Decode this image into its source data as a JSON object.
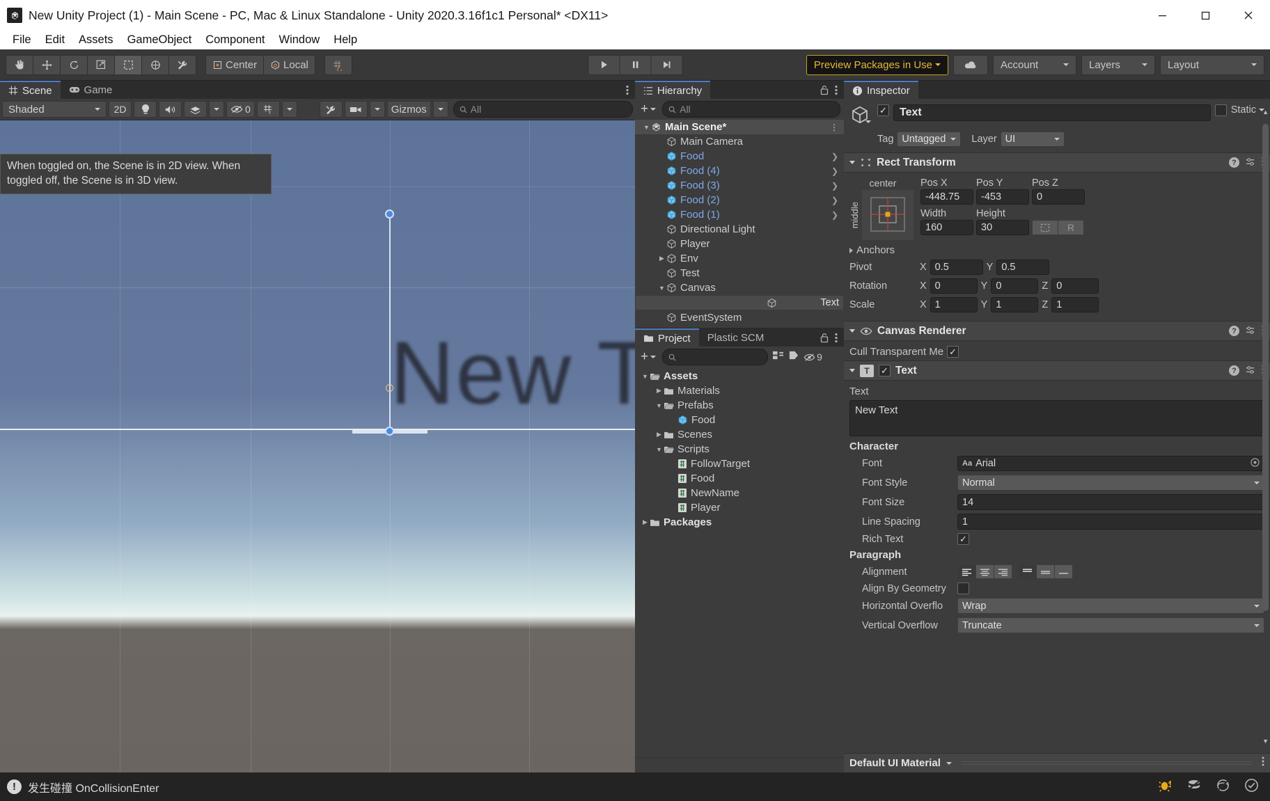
{
  "window": {
    "title": "New Unity Project (1) - Main Scene - PC, Mac & Linux Standalone - Unity 2020.3.16f1c1 Personal* <DX11>",
    "app_icon": "unity-icon",
    "minimize": "–",
    "maximize": "☐",
    "close": "✕"
  },
  "menubar": {
    "items": [
      "File",
      "Edit",
      "Assets",
      "GameObject",
      "Component",
      "Window",
      "Help"
    ]
  },
  "toolbar": {
    "tools": [
      {
        "name": "hand-tool",
        "glyph": "✋"
      },
      {
        "name": "move-tool",
        "glyph": "✥"
      },
      {
        "name": "rotate-tool",
        "glyph": "⟳"
      },
      {
        "name": "scale-tool",
        "glyph": "↗"
      },
      {
        "name": "rect-tool",
        "glyph": "⬚"
      },
      {
        "name": "transform-tool",
        "glyph": "⊕"
      },
      {
        "name": "custom-editor-tool",
        "glyph": "⚒"
      }
    ],
    "pivot_label": "Center",
    "rotation_label": "Local",
    "grid_label": "",
    "play": "▶",
    "pause": "‖",
    "step": "▶|",
    "preview_packages": "Preview Packages in Use",
    "cloud_label": "cloud-icon",
    "account": "Account",
    "layers": "Layers",
    "layout": "Layout"
  },
  "scene": {
    "tabs": [
      {
        "label": "Scene",
        "icon": "grid-icon",
        "active": true
      },
      {
        "label": "Game",
        "icon": "gamepad-icon",
        "active": false
      }
    ],
    "draw_mode": "Shaded",
    "toggle_2d": "2D",
    "lighting_icon": "lightbulb-icon",
    "audio_icon": "speaker-icon",
    "fx_icon": "fx-icon",
    "hidden_count": "0",
    "grid_icon": "grid-visibility-icon",
    "tools_icon": "component-tools-icon",
    "camera_icon": "scene-camera-icon",
    "gizmos_label": "Gizmos",
    "search_placeholder": "All",
    "tooltip": "When toggled on, the Scene is in 2D view. When toggled off, the Scene is in 3D view.",
    "viewport_text": "New T"
  },
  "hierarchy": {
    "tab_label": "Hierarchy",
    "tab_icon": "hierarchy-icon",
    "lock_icon": "lock-icon",
    "menu_icon": "kebab-icon",
    "add_label": "+",
    "search_placeholder": "All",
    "items": [
      {
        "label": "Main Scene*",
        "depth": 0,
        "icon": "unity-scene-icon",
        "expanded": true,
        "kind": "scene",
        "selected": false,
        "prefab": false
      },
      {
        "label": "Main Camera",
        "depth": 1,
        "icon": "gameobject-icon",
        "kind": "go",
        "blue": false,
        "prefab": false
      },
      {
        "label": "Food",
        "depth": 1,
        "icon": "prefab-icon",
        "kind": "prefab",
        "blue": true,
        "prefab": true
      },
      {
        "label": "Food (4)",
        "depth": 1,
        "icon": "prefab-icon",
        "kind": "prefab",
        "blue": true,
        "prefab": true
      },
      {
        "label": "Food (3)",
        "depth": 1,
        "icon": "prefab-icon",
        "kind": "prefab",
        "blue": true,
        "prefab": true
      },
      {
        "label": "Food (2)",
        "depth": 1,
        "icon": "prefab-icon",
        "kind": "prefab",
        "blue": true,
        "prefab": true
      },
      {
        "label": "Food (1)",
        "depth": 1,
        "icon": "prefab-icon",
        "kind": "prefab",
        "blue": true,
        "prefab": true
      },
      {
        "label": "Directional Light",
        "depth": 1,
        "icon": "gameobject-icon",
        "kind": "go",
        "blue": false,
        "prefab": false
      },
      {
        "label": "Player",
        "depth": 1,
        "icon": "gameobject-icon",
        "kind": "go",
        "blue": false,
        "prefab": false
      },
      {
        "label": "Env",
        "depth": 1,
        "icon": "gameobject-icon",
        "kind": "go",
        "blue": false,
        "prefab": false,
        "collapsed": true
      },
      {
        "label": "Test",
        "depth": 1,
        "icon": "gameobject-icon",
        "kind": "go",
        "blue": false,
        "prefab": false
      },
      {
        "label": "Canvas",
        "depth": 1,
        "icon": "gameobject-icon",
        "kind": "go",
        "blue": false,
        "prefab": false,
        "expanded": true
      },
      {
        "label": "Text",
        "depth": 2,
        "icon": "gameobject-icon",
        "kind": "go",
        "blue": false,
        "prefab": false,
        "selected": true
      },
      {
        "label": "EventSystem",
        "depth": 1,
        "icon": "gameobject-icon",
        "kind": "go",
        "blue": false,
        "prefab": false
      }
    ]
  },
  "project": {
    "tabs": [
      {
        "label": "Project",
        "icon": "folder-icon",
        "active": true
      },
      {
        "label": "Plastic SCM",
        "icon": "",
        "active": false
      }
    ],
    "lock_icon": "lock-icon",
    "menu_icon": "kebab-icon",
    "add_label": "+",
    "search_placeholder": "",
    "badge_count": "9",
    "items": [
      {
        "label": "Assets",
        "depth": 0,
        "icon": "folder-open-icon",
        "expanded": true,
        "bold": true
      },
      {
        "label": "Materials",
        "depth": 1,
        "icon": "folder-icon",
        "expanded": false
      },
      {
        "label": "Prefabs",
        "depth": 1,
        "icon": "folder-open-icon",
        "expanded": true
      },
      {
        "label": "Food",
        "depth": 2,
        "icon": "prefab-icon"
      },
      {
        "label": "Scenes",
        "depth": 1,
        "icon": "folder-icon",
        "expanded": false
      },
      {
        "label": "Scripts",
        "depth": 1,
        "icon": "folder-open-icon",
        "expanded": true
      },
      {
        "label": "FollowTarget",
        "depth": 2,
        "icon": "csharp-icon"
      },
      {
        "label": "Food",
        "depth": 2,
        "icon": "csharp-icon"
      },
      {
        "label": "NewName",
        "depth": 2,
        "icon": "csharp-icon"
      },
      {
        "label": "Player",
        "depth": 2,
        "icon": "csharp-icon"
      },
      {
        "label": "Packages",
        "depth": 0,
        "icon": "folder-icon",
        "expanded": false,
        "bold": true
      }
    ]
  },
  "inspector": {
    "tab_label": "Inspector",
    "tab_icon": "info-icon",
    "object_name": "Text",
    "enabled": true,
    "static_label": "Static",
    "static_checked": false,
    "tag_label": "Tag",
    "tag_value": "Untagged",
    "layer_label": "Layer",
    "layer_value": "UI",
    "rect_transform": {
      "title": "Rect Transform",
      "anchor_preset_h": "center",
      "anchor_preset_v": "middle",
      "fields": [
        {
          "label": "Pos X",
          "value": "-448.75"
        },
        {
          "label": "Pos Y",
          "value": "-453"
        },
        {
          "label": "Pos Z",
          "value": "0"
        }
      ],
      "size_fields": [
        {
          "label": "Width",
          "value": "160"
        },
        {
          "label": "Height",
          "value": "30"
        }
      ],
      "blueprint_btn": "blueprint-mode-icon",
      "raw_btn": "R",
      "anchors_label": "Anchors",
      "pivot_label": "Pivot",
      "pivot_x": "0.5",
      "pivot_y": "0.5",
      "rotation_label": "Rotation",
      "rotation": [
        "0",
        "0",
        "0"
      ],
      "scale_label": "Scale",
      "scale": [
        "1",
        "1",
        "1"
      ],
      "axes": [
        "X",
        "Y",
        "Z"
      ]
    },
    "canvas_renderer": {
      "title": "Canvas Renderer",
      "cull_label": "Cull Transparent Me",
      "cull_checked": true
    },
    "text_component": {
      "title": "Text",
      "enabled": true,
      "text_label": "Text",
      "text_value": "New Text",
      "character_header": "Character",
      "font_label": "Font",
      "font_value": "Arial",
      "font_style_label": "Font Style",
      "font_style_value": "Normal",
      "font_size_label": "Font Size",
      "font_size_value": "14",
      "line_spacing_label": "Line Spacing",
      "line_spacing_value": "1",
      "rich_text_label": "Rich Text",
      "rich_text_checked": true,
      "paragraph_header": "Paragraph",
      "alignment_label": "Alignment",
      "alignment_h_index": 0,
      "alignment_v_index": 0,
      "align_geometry_label": "Align By Geometry",
      "align_geometry_checked": false,
      "h_overflow_label": "Horizontal Overflo",
      "h_overflow_value": "Wrap",
      "v_overflow_label": "Vertical Overflow",
      "v_overflow_value": "Truncate"
    },
    "material_bar": "Default UI Material"
  },
  "statusbar": {
    "icon": "error-icon",
    "message": "发生碰撞 OnCollisionEnter",
    "right_icons": [
      {
        "name": "bug-icon",
        "color": "#e8a81c"
      },
      {
        "name": "collab-off-icon",
        "color": "#b8b8b8"
      },
      {
        "name": "cloud-off-icon",
        "color": "#b8b8b8"
      },
      {
        "name": "check-circle-icon",
        "color": "#b8b8b8"
      }
    ]
  },
  "colors": {
    "accent_yellow": "#e8b63a",
    "prefab_blue": "#7ea9e8",
    "panel_bg": "#3c3c3c",
    "toolbar_bg": "#383838"
  }
}
